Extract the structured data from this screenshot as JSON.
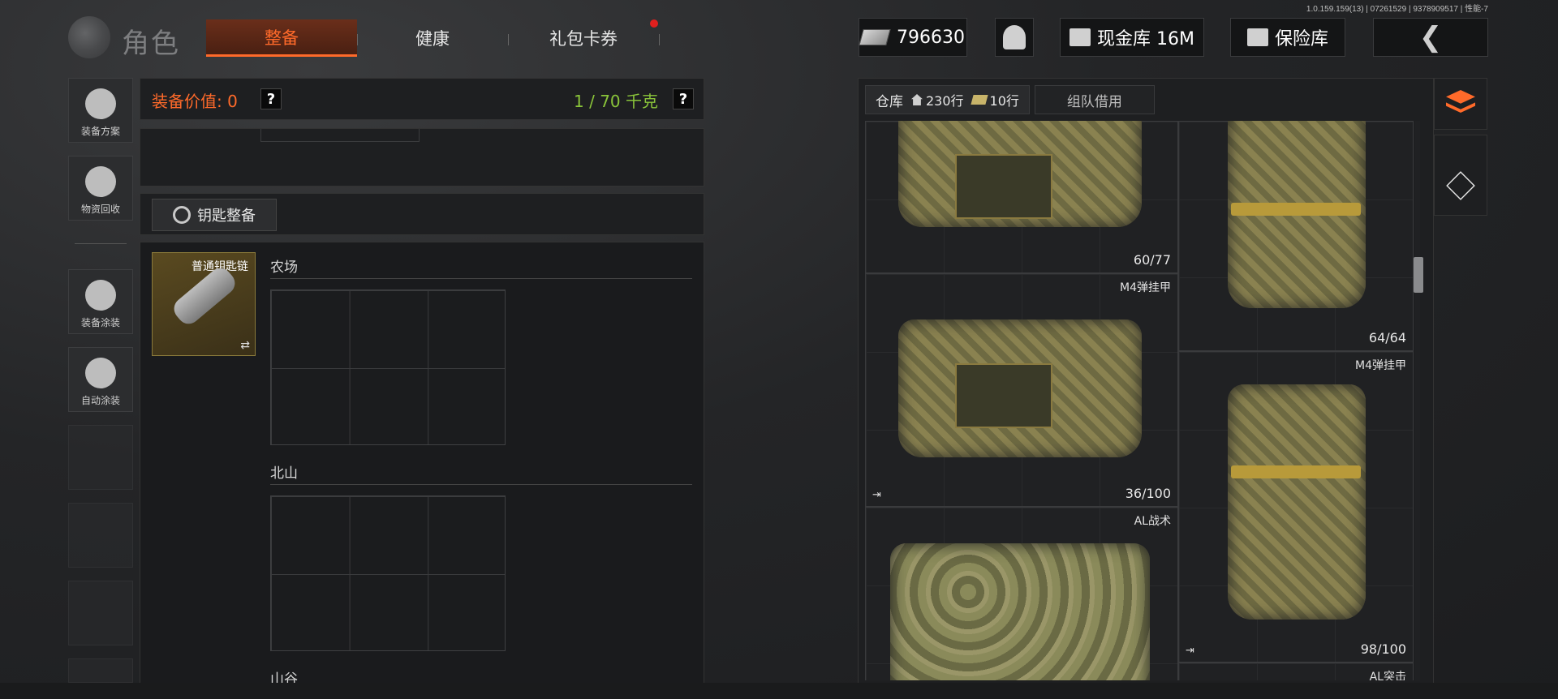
{
  "version": "1.0.159.159(13) | 07261529 | 9378909517 | 性能-7",
  "header": {
    "title": "角色",
    "tabs": [
      {
        "label": "整备",
        "active": true
      },
      {
        "label": "健康",
        "active": false
      },
      {
        "label": "礼包卡券",
        "active": false,
        "notify": true
      }
    ],
    "cash": "796630",
    "cash_vault": "现金库 16M",
    "safe_vault": "保险库",
    "back_icon": "back-arrow-icon"
  },
  "sidebar": {
    "items": [
      {
        "label": "装备方案",
        "icon": "helmet-grid-icon"
      },
      {
        "label": "物资回收",
        "icon": "recycle-icon"
      },
      {
        "label": "装备涂装",
        "icon": "helmet-paint-icon"
      },
      {
        "label": "自动涂装",
        "icon": "brush-gear-icon"
      }
    ]
  },
  "loadout": {
    "value_label": "装备价值: 0",
    "help": "?",
    "weight": "1 / 70 千克",
    "key_button": "钥匙整备",
    "keychain": {
      "name": "普通钥匙链",
      "swap": "⇄"
    },
    "regions": [
      "农场",
      "北山",
      "山谷"
    ]
  },
  "warehouse": {
    "tab_label": "仓库",
    "rows_home": "230行",
    "rows_cash": "10行",
    "team_tab": "组队借用",
    "items": [
      {
        "name": "",
        "durability": "60/77",
        "exit": ""
      },
      {
        "name": "",
        "durability": "64/64",
        "exit": ""
      },
      {
        "name": "M4弹挂甲",
        "durability": "36/100",
        "exit": "⇥"
      },
      {
        "name": "M4弹挂甲",
        "durability": "98/100",
        "exit": "⇥"
      },
      {
        "name": "AL战术",
        "durability": "",
        "exit": ""
      },
      {
        "name": "AL突击",
        "durability": "",
        "exit": ""
      }
    ]
  },
  "colors": {
    "accent": "#ff6a2a",
    "weight_green": "#8ac43a",
    "notify_red": "#e0201e"
  }
}
